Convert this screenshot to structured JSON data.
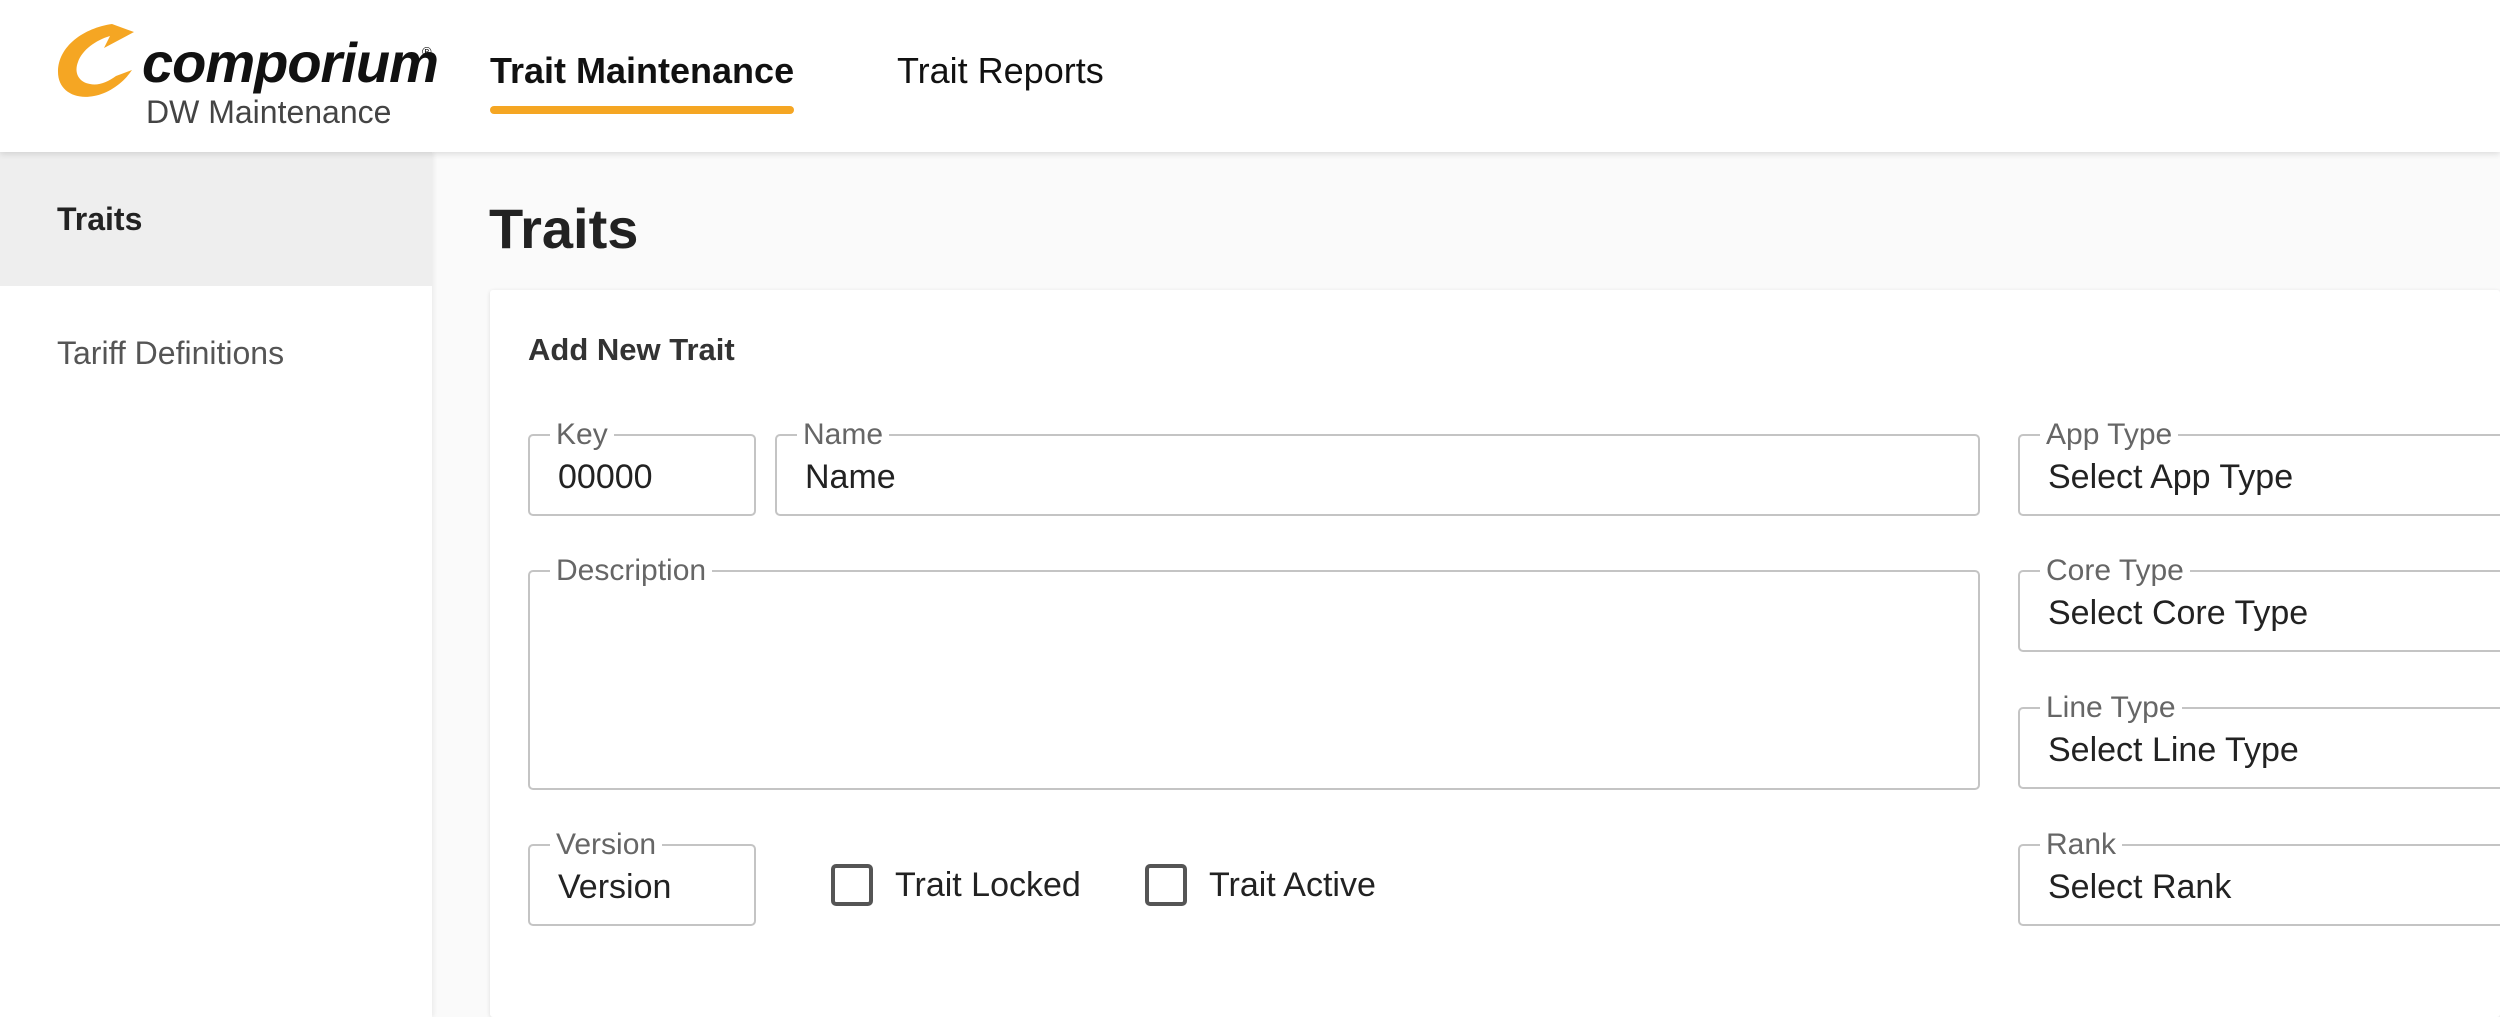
{
  "header": {
    "brand": "comporium",
    "brand_reg": "®",
    "subtitle": "DW Maintenance",
    "accent_color": "#f5a623",
    "tabs": [
      {
        "label": "Trait Maintenance",
        "active": true
      },
      {
        "label": "Trait Reports",
        "active": false
      }
    ]
  },
  "sidebar": {
    "items": [
      {
        "label": "Traits",
        "active": true
      },
      {
        "label": "Tariff Definitions",
        "active": false
      }
    ]
  },
  "main": {
    "page_title": "Traits",
    "form": {
      "title": "Add New Trait",
      "key": {
        "label": "Key",
        "value": "00000"
      },
      "name": {
        "label": "Name",
        "value": "Name"
      },
      "description": {
        "label": "Description",
        "value": ""
      },
      "version": {
        "label": "Version",
        "value": "Version"
      },
      "trait_locked": {
        "label": "Trait Locked",
        "checked": false
      },
      "trait_active": {
        "label": "Trait Active",
        "checked": false
      },
      "app_type": {
        "label": "App Type",
        "value": "Select App Type"
      },
      "core_type": {
        "label": "Core Type",
        "value": "Select Core Type"
      },
      "line_type": {
        "label": "Line Type",
        "value": "Select Line Type"
      },
      "rank": {
        "label": "Rank",
        "value": "Select Rank"
      }
    }
  }
}
